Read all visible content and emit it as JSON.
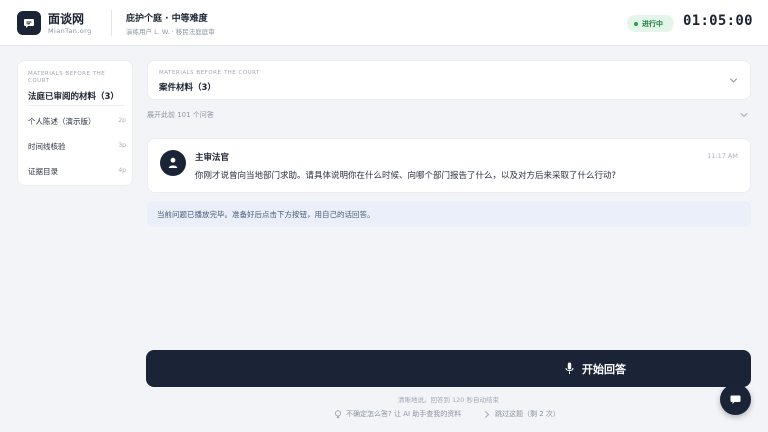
{
  "brand": {
    "name": "面谈网",
    "domain": "MianTan.org"
  },
  "session": {
    "title": "庇护个庭 · 中等难度",
    "subtitle": "演练用户 L. W. · 移民法庭庭审"
  },
  "status": {
    "label": "进行中",
    "color": "#27a04b"
  },
  "timer": "01:05:00",
  "sidebar": {
    "caption": "MATERIALS BEFORE THE COURT",
    "title": "法庭已审阅的材料（3）",
    "items": [
      {
        "label": "个人陈述（演示版）",
        "pages": "2p"
      },
      {
        "label": "时间线核验",
        "pages": "3p"
      },
      {
        "label": "证据目录",
        "pages": "4p"
      }
    ]
  },
  "materials": {
    "caption": "MATERIALS BEFORE THE COURT",
    "title": "案件材料（3）"
  },
  "history": {
    "expand_label": "展开此前 101 个问答"
  },
  "message": {
    "sender": "主审法官",
    "time": "11:17 AM",
    "text": "你刚才说曾向当地部门求助。请具体说明你在什么时候、向哪个部门报告了什么，以及对方后来采取了什么行动?"
  },
  "notice": {
    "text": "当前问题已播放完毕。准备好后点击下方按钮，用自己的话回答。"
  },
  "actions": {
    "start_label": "开始回答",
    "hint": "清晰地说。回答到 120 秒自动结束",
    "help_label": "不确定怎么答? 让 AI 助手查我的资料",
    "skip_label": "跳过这题（剩 2 次）"
  },
  "icons": {
    "logo": "chat-bubble-icon",
    "avatar": "person-icon",
    "start": "microphone-icon",
    "help": "lightbulb-icon",
    "skip": "chevron-right-icon",
    "fab": "chat-icon"
  },
  "colors": {
    "primary": "#1b2337",
    "background": "#f3f4f7",
    "notice_bg": "#eaeff9"
  }
}
